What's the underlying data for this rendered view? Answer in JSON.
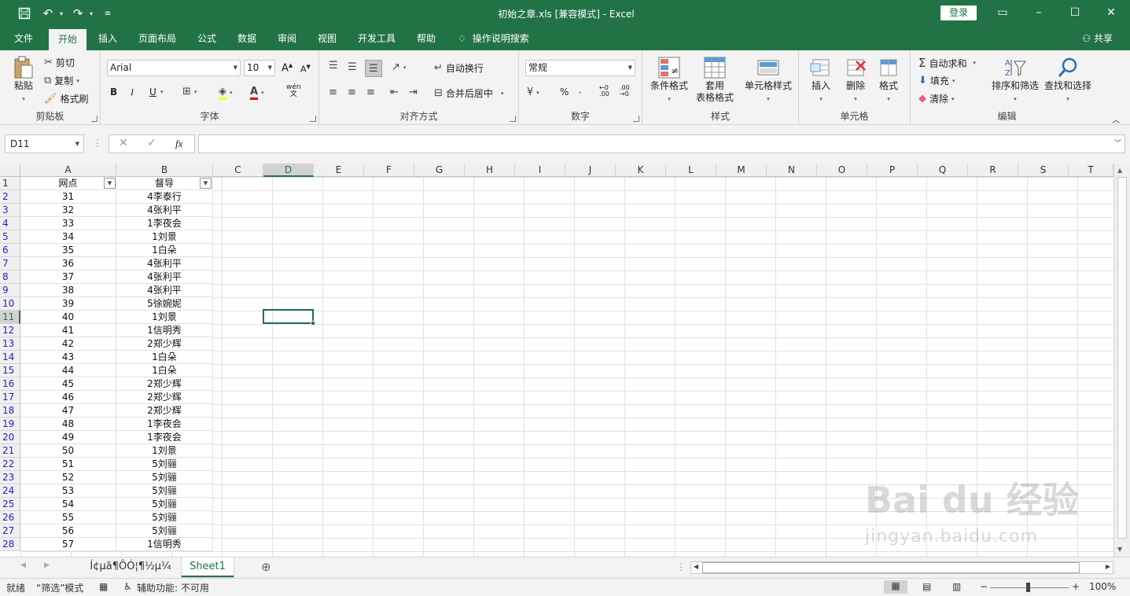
{
  "titlebar": {
    "title": "初始之章.xls  [兼容模式]  -  Excel",
    "login_label": "登录",
    "icons": [
      "save-icon",
      "undo-icon",
      "redo-icon",
      "customize-icon"
    ]
  },
  "tabs": [
    "文件",
    "开始",
    "插入",
    "页面布局",
    "公式",
    "数据",
    "审阅",
    "视图",
    "开发工具",
    "帮助"
  ],
  "tell_me": "操作说明搜索",
  "share_label": "共享",
  "ribbon": {
    "clipboard": {
      "label": "剪贴板",
      "paste": "粘贴",
      "cut": "剪切",
      "copy": "复制",
      "format_painter": "格式刷"
    },
    "font": {
      "label": "字体",
      "font_name": "Arial",
      "font_size": "10",
      "bold": "B",
      "italic": "I",
      "underline": "U",
      "pinyin": "wén"
    },
    "alignment": {
      "label": "对齐方式",
      "wrap_text": "自动换行",
      "merge_center": "合并后居中"
    },
    "number": {
      "label": "数字",
      "format": "常规",
      "percent": "%"
    },
    "styles": {
      "label": "样式",
      "conditional": "条件格式",
      "table_line1": "套用",
      "table_line2": "表格格式",
      "cell_styles": "单元格样式"
    },
    "cells": {
      "label": "单元格",
      "insert": "插入",
      "delete": "删除",
      "format": "格式"
    },
    "editing": {
      "label": "编辑",
      "autosum": "自动求和",
      "fill": "填充",
      "clear": "清除",
      "sort_filter": "排序和筛选",
      "find_select": "查找和选择"
    }
  },
  "formula_bar": {
    "name_box": "D11",
    "fx": "fx",
    "value": ""
  },
  "columns": [
    "A",
    "B",
    "C",
    "D",
    "E",
    "F",
    "G",
    "H",
    "I",
    "J",
    "K",
    "L",
    "M",
    "N",
    "O",
    "P",
    "Q",
    "R",
    "S",
    "T"
  ],
  "selected_column": "D",
  "rows": [
    {
      "n": "1",
      "a": "网点",
      "b": "督导"
    },
    {
      "n": "2",
      "a": "31",
      "b": "4李泰行"
    },
    {
      "n": "3",
      "a": "32",
      "b": "4张利平"
    },
    {
      "n": "4",
      "a": "33",
      "b": "1李夜会"
    },
    {
      "n": "5",
      "a": "34",
      "b": "1刘景"
    },
    {
      "n": "6",
      "a": "35",
      "b": "1白朵"
    },
    {
      "n": "7",
      "a": "36",
      "b": "4张利平"
    },
    {
      "n": "8",
      "a": "37",
      "b": "4张利平"
    },
    {
      "n": "9",
      "a": "38",
      "b": "4张利平"
    },
    {
      "n": "10",
      "a": "39",
      "b": "5徐婉妮"
    },
    {
      "n": "11",
      "a": "40",
      "b": "1刘景"
    },
    {
      "n": "12",
      "a": "41",
      "b": "1信明秀"
    },
    {
      "n": "13",
      "a": "42",
      "b": "2郑少辉"
    },
    {
      "n": "14",
      "a": "43",
      "b": "1白朵"
    },
    {
      "n": "15",
      "a": "44",
      "b": "1白朵"
    },
    {
      "n": "16",
      "a": "45",
      "b": "2郑少辉"
    },
    {
      "n": "17",
      "a": "46",
      "b": "2郑少辉"
    },
    {
      "n": "18",
      "a": "47",
      "b": "2郑少辉"
    },
    {
      "n": "19",
      "a": "48",
      "b": "1李夜会"
    },
    {
      "n": "20",
      "a": "49",
      "b": "1李夜会"
    },
    {
      "n": "21",
      "a": "50",
      "b": "1刘景"
    },
    {
      "n": "22",
      "a": "51",
      "b": "5刘骊"
    },
    {
      "n": "23",
      "a": "52",
      "b": "5刘骊"
    },
    {
      "n": "24",
      "a": "53",
      "b": "5刘骊"
    },
    {
      "n": "25",
      "a": "54",
      "b": "5刘骊"
    },
    {
      "n": "26",
      "a": "55",
      "b": "5刘骊"
    },
    {
      "n": "27",
      "a": "56",
      "b": "5刘骊"
    },
    {
      "n": "28",
      "a": "57",
      "b": "1信明秀"
    }
  ],
  "selected_row": "11",
  "sheets": [
    "Í¢µã¶ÔÓ¦¶½µ¼",
    "Sheet1"
  ],
  "active_sheet": "Sheet1",
  "status": {
    "ready": "就绪",
    "filter_mode": "“筛选”模式",
    "accessibility": "辅助功能: 不可用",
    "zoom": "100%"
  },
  "watermark": {
    "brand": "Bai du 经验",
    "url": "jingyan.baidu.com"
  },
  "colors": {
    "accent": "#217346"
  }
}
